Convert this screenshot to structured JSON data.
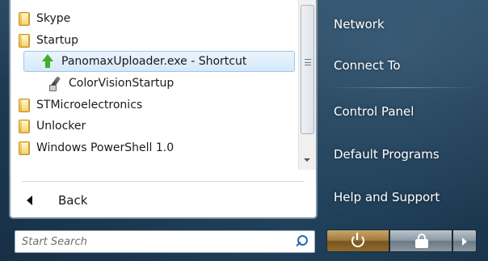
{
  "programs": {
    "items": [
      {
        "label": "Skype",
        "icon": "folder-icon"
      },
      {
        "label": "Startup",
        "icon": "folder-icon"
      },
      {
        "label": "PanomaxUploader.exe - Shortcut",
        "icon": "arrow-up-icon",
        "selected": true
      },
      {
        "label": "ColorVisionStartup",
        "icon": "brush-icon"
      },
      {
        "label": "STMicroelectronics",
        "icon": "folder-icon"
      },
      {
        "label": "Unlocker",
        "icon": "folder-icon"
      },
      {
        "label": "Windows PowerShell 1.0",
        "icon": "folder-icon"
      }
    ]
  },
  "back": {
    "label": "Back"
  },
  "search": {
    "placeholder": "Start Search"
  },
  "right_menu": {
    "items": [
      {
        "label": "Network"
      },
      {
        "label": "Connect To"
      },
      {
        "label": "Control Panel"
      },
      {
        "label": "Default Programs"
      },
      {
        "label": "Help and Support"
      }
    ]
  },
  "power": {
    "shutdown_icon": "power-icon",
    "lock_icon": "lock-icon",
    "more_icon": "chevron-right-icon"
  },
  "colors": {
    "selection": "#d6e9f9",
    "selection_border": "#9ec7ea",
    "search_icon": "#2a67b3"
  }
}
